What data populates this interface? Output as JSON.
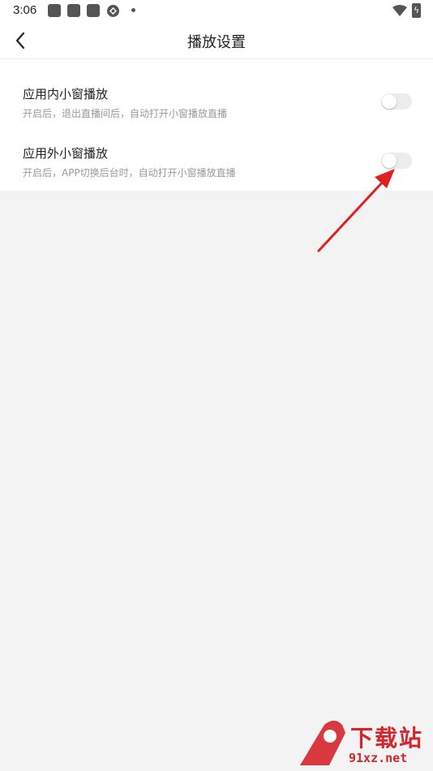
{
  "status_bar": {
    "time": "3:06",
    "notification_icons": [
      "app-icon",
      "app-icon",
      "app-icon",
      "sync-icon"
    ],
    "wifi_icon": "wifi-icon",
    "battery_icon": "battery-charging-icon"
  },
  "header": {
    "back_icon": "chevron-left-icon",
    "title": "播放设置"
  },
  "settings": [
    {
      "title": "应用内小窗播放",
      "description": "开启后，退出直播间后，自动打开小窗播放直播",
      "enabled": false
    },
    {
      "title": "应用外小窗播放",
      "description": "开启后，APP切换后台时，自动打开小窗播放直播",
      "enabled": false
    }
  ],
  "annotation": {
    "arrow_color": "#e02020"
  },
  "watermark": {
    "logo_text": "下载站",
    "logo_subtext": "91xz.net",
    "color": "#d6252a"
  }
}
